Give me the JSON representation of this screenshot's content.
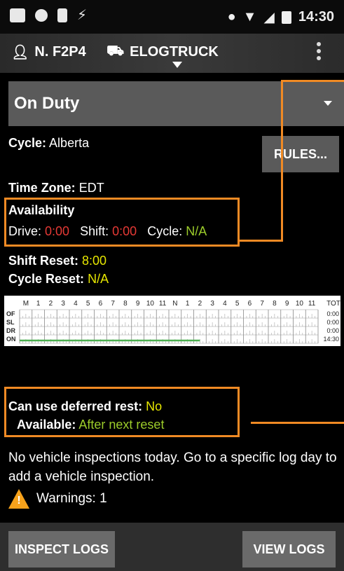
{
  "status_bar": {
    "time": "14:30"
  },
  "header": {
    "driver": "N. F2P4",
    "truck": "ELOGTRUCK"
  },
  "duty_status": "On Duty",
  "cycle": {
    "label": "Cycle:",
    "value": "Alberta"
  },
  "rules_button": "RULES...",
  "time_zone": {
    "label": "Time Zone:",
    "value": "EDT"
  },
  "availability": {
    "title": "Availability",
    "drive_label": "Drive:",
    "drive_value": "0:00",
    "shift_label": "Shift:",
    "shift_value": "0:00",
    "cycle_label": "Cycle:",
    "cycle_value": "N/A"
  },
  "shift_reset": {
    "label": "Shift Reset:",
    "value": "8:00"
  },
  "cycle_reset": {
    "label": "Cycle Reset:",
    "value": "N/A"
  },
  "chart_data": {
    "type": "line",
    "hour_labels": [
      "M",
      "1",
      "2",
      "3",
      "4",
      "5",
      "6",
      "7",
      "8",
      "9",
      "10",
      "11",
      "N",
      "1",
      "2",
      "3",
      "4",
      "5",
      "6",
      "7",
      "8",
      "9",
      "10",
      "11"
    ],
    "total_label": "TOT",
    "rows": [
      {
        "name": "OF",
        "total": "0:00"
      },
      {
        "name": "SL",
        "total": "0:00"
      },
      {
        "name": "DR",
        "total": "0:00"
      },
      {
        "name": "ON",
        "total": "14:30"
      }
    ],
    "segments": [
      {
        "status": "ON",
        "start_hour": 0,
        "end_hour": 14.5
      }
    ],
    "line_color": "#4caf50"
  },
  "deferred_rest": {
    "can_use_label": "Can use deferred rest:",
    "can_use_value": "No",
    "available_label": "Available:",
    "available_value": "After next reset"
  },
  "inspection_message": "No vehicle inspections today. Go to a specific log day to add a vehicle inspection.",
  "warnings": "Warnings: 1",
  "footer": {
    "inspect_logs": "INSPECT LOGS",
    "view_logs": "VIEW LOGS"
  },
  "colors": {
    "accent_orange": "#f08a24",
    "red": "#e53935",
    "yellow": "#e6e600",
    "green": "#9ccc2a"
  }
}
